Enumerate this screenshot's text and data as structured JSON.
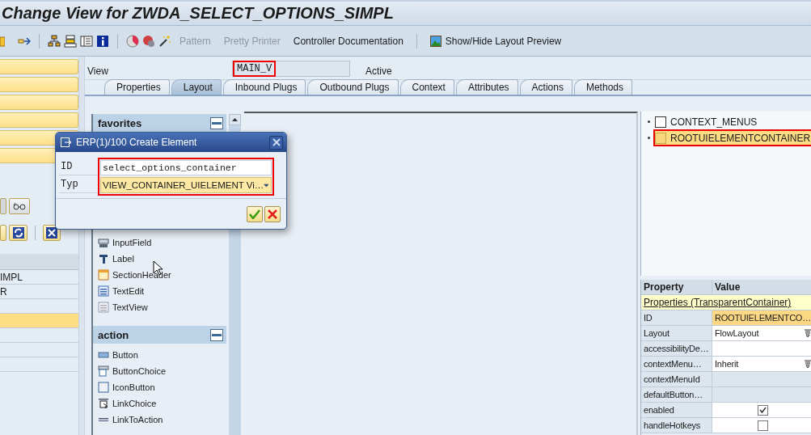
{
  "window": {
    "title": "Change View for ZWDA_SELECT_OPTIONS_SIMPL"
  },
  "toolbar": {
    "buttons": [
      {
        "label": "Pattern",
        "disabled": true
      },
      {
        "label": "Pretty Printer",
        "disabled": true
      },
      {
        "label": "Controller Documentation",
        "disabled": false
      }
    ],
    "preview_button": {
      "label": "Show/Hide Layout Preview"
    }
  },
  "left_panel": {
    "list": [
      {
        "text": "IMPL",
        "selected": false
      },
      {
        "text": "R",
        "selected": false
      },
      {
        "selected": false
      },
      {
        "selected": true
      },
      {
        "selected": false
      },
      {
        "selected": false
      },
      {
        "selected": false
      }
    ]
  },
  "view_header": {
    "label": "View",
    "name": "MAIN_V",
    "status": "Active"
  },
  "tabs": [
    {
      "label": "Properties",
      "selected": false
    },
    {
      "label": "Layout",
      "selected": true
    },
    {
      "label": "Inbound Plugs",
      "selected": false
    },
    {
      "label": "Outbound Plugs",
      "selected": false
    },
    {
      "label": "Context",
      "selected": false
    },
    {
      "label": "Attributes",
      "selected": false
    },
    {
      "label": "Actions",
      "selected": false
    },
    {
      "label": "Methods",
      "selected": false
    }
  ],
  "palette": {
    "groups": [
      {
        "title": "favorites",
        "items": [
          {
            "label": "InputField",
            "kind": "input"
          },
          {
            "label": "Label",
            "kind": "label"
          },
          {
            "label": "SectionHeader",
            "kind": "section"
          },
          {
            "label": "TextEdit",
            "kind": "textedit"
          },
          {
            "label": "TextView",
            "kind": "textview"
          }
        ]
      },
      {
        "title": "action",
        "items": [
          {
            "label": "Button",
            "kind": "button"
          },
          {
            "label": "ButtonChoice",
            "kind": "buttonchoice"
          },
          {
            "label": "IconButton",
            "kind": "iconbutton"
          },
          {
            "label": "LinkChoice",
            "kind": "linkchoice"
          },
          {
            "label": "LinkToAction",
            "kind": "link"
          }
        ]
      }
    ]
  },
  "tree": [
    {
      "label": "CONTEXT_MENUS",
      "selected": false
    },
    {
      "label": "ROOTUIELEMENTCONTAINER",
      "selected": true
    }
  ],
  "properties": {
    "columns": [
      "Property",
      "Value"
    ],
    "section": "Properties (TransparentContainer)",
    "rows": [
      {
        "name": "ID",
        "kind": "key",
        "value": "ROOTUIELEMENTCO…"
      },
      {
        "name": "Layout",
        "kind": "dropdown",
        "value": "FlowLayout"
      },
      {
        "name": "accessibilityDe…",
        "kind": "text"
      },
      {
        "name": "contextMenu…",
        "kind": "dropdown",
        "value": "Inherit"
      },
      {
        "name": "contextMenuId",
        "kind": "readonly"
      },
      {
        "name": "defaultButton…",
        "kind": "readonly"
      },
      {
        "name": "enabled",
        "kind": "checkbox",
        "checked": true
      },
      {
        "name": "handleHotkeys",
        "kind": "checkbox",
        "checked": false
      }
    ]
  },
  "dialog": {
    "title": "ERP(1)/100 Create Element",
    "fields": [
      {
        "label": "ID",
        "kind": "input",
        "value": "select_options_container"
      },
      {
        "label": "Typ",
        "kind": "dropdown",
        "value": "VIEW_CONTAINER_UIELEMENT Vi…"
      }
    ]
  }
}
